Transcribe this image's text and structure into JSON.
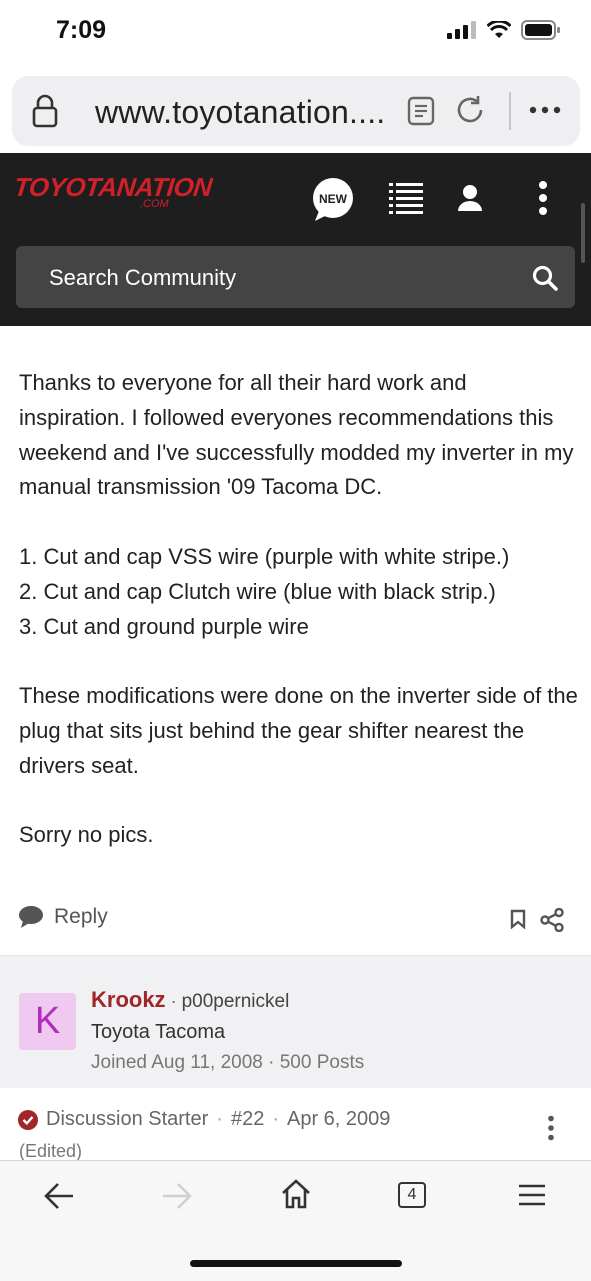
{
  "status_bar": {
    "time": "7:09"
  },
  "browser": {
    "url": "www.toyotanation...."
  },
  "site": {
    "logo_main": "TOYOTANATION",
    "logo_sub": ".COM",
    "new_badge": "NEW",
    "search_placeholder": "Search Community",
    "brand_color": "#d0202a"
  },
  "post": {
    "paragraphs": [
      "Thanks to everyone for all their hard work and inspiration. I followed everyones recommendations this weekend and I've successfully modded my inverter in my manual transmission '09 Tacoma DC.",
      "1. Cut and cap VSS wire (purple with white stripe.)\n2. Cut and cap Clutch wire (blue with black strip.)\n3. Cut and ground purple wire",
      "These modifications were done on the inverter side of the plug that sits just behind the gear shifter nearest the drivers seat.",
      "Sorry no pics."
    ],
    "reply_label": "Reply"
  },
  "next_post": {
    "avatar_letter": "K",
    "author": "Krookz",
    "username": "p00pernickel",
    "vehicle": "Toyota Tacoma",
    "joined": "Joined Aug 11, 2008 · 500 Posts",
    "badge": "Discussion Starter",
    "number": "#22",
    "date": "Apr 6, 2009",
    "edited": "(Edited)"
  },
  "toolbar": {
    "tab_count": "4"
  }
}
